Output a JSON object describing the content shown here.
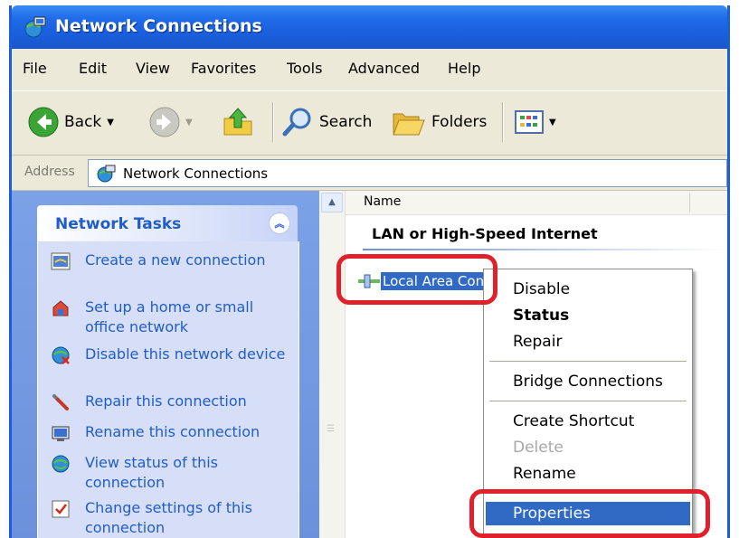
{
  "window": {
    "title": "Network Connections",
    "accent": "#1f6be8"
  },
  "menu": [
    "File",
    "Edit",
    "View",
    "Favorites",
    "Tools",
    "Advanced",
    "Help"
  ],
  "toolbar": {
    "back_label": "Back",
    "search_label": "Search",
    "folders_label": "Folders"
  },
  "address": {
    "label": "Address",
    "value": "Network Connections"
  },
  "tasks_panel": {
    "title": "Network Tasks",
    "items": [
      {
        "label": "Create a new connection",
        "icon": "new-connection-icon"
      },
      {
        "label": "Set up a home or small office network",
        "icon": "home-network-icon"
      },
      {
        "label": "Disable this network device",
        "icon": "disable-device-icon"
      },
      {
        "label": "Repair this connection",
        "icon": "repair-wrench-icon"
      },
      {
        "label": "Rename this connection",
        "icon": "rename-icon"
      },
      {
        "label": "View status of this connection",
        "icon": "status-globe-icon"
      },
      {
        "label": "Change settings of this connection",
        "icon": "settings-check-icon"
      }
    ]
  },
  "content": {
    "column_name": "Name",
    "group_heading": "LAN or High-Speed Internet",
    "selected_item": "Local Area Con"
  },
  "context_menu": {
    "items": [
      {
        "label": "Disable",
        "style": "normal"
      },
      {
        "label": "Status",
        "style": "bold"
      },
      {
        "label": "Repair",
        "style": "normal"
      },
      {
        "label": "Bridge Connections",
        "style": "normal"
      },
      {
        "label": "Create Shortcut",
        "style": "normal"
      },
      {
        "label": "Delete",
        "style": "disabled"
      },
      {
        "label": "Rename",
        "style": "normal"
      },
      {
        "label": "Properties",
        "style": "selected"
      }
    ]
  },
  "highlight_color": "#e0202a"
}
